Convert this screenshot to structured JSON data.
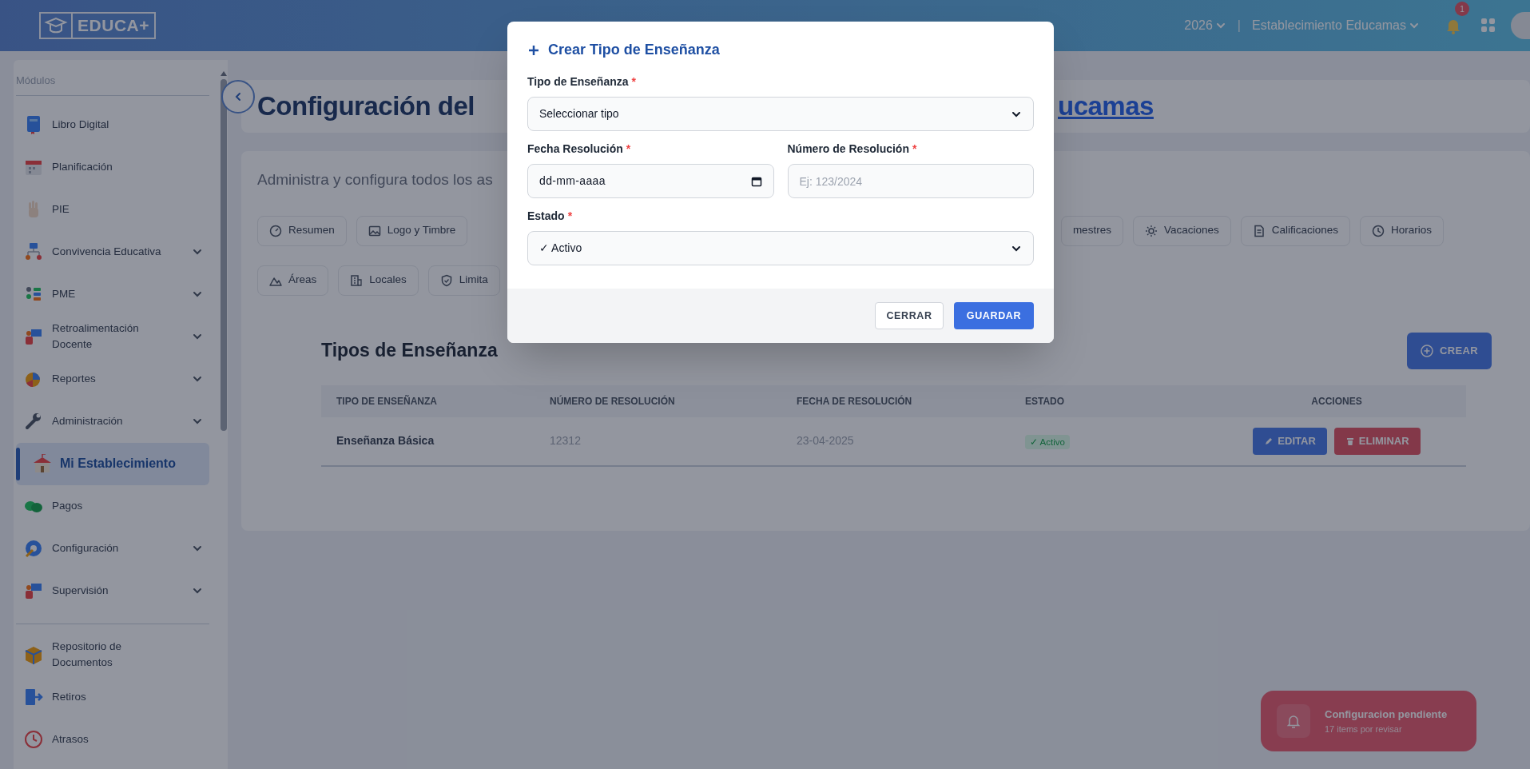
{
  "header": {
    "logo_text": "EDUCA+",
    "year": "2026",
    "separator": "|",
    "school": "Establecimiento Educamas",
    "notification_count": "1"
  },
  "sidebar": {
    "section": "Módulos",
    "items": [
      {
        "label": "Libro Digital",
        "expandable": false,
        "selected": false
      },
      {
        "label": "Planificación",
        "expandable": false,
        "selected": false
      },
      {
        "label": "PIE",
        "expandable": false,
        "selected": false
      },
      {
        "label": "Convivencia Educativa",
        "expandable": true,
        "selected": false
      },
      {
        "label": "PME",
        "expandable": true,
        "selected": false
      },
      {
        "label": "Retroalimentación Docente",
        "expandable": true,
        "selected": false
      },
      {
        "label": "Reportes",
        "expandable": true,
        "selected": false
      },
      {
        "label": "Administración",
        "expandable": true,
        "selected": false
      },
      {
        "label": "Mi Establecimiento",
        "expandable": false,
        "selected": true
      },
      {
        "label": "Pagos",
        "expandable": false,
        "selected": false
      },
      {
        "label": "Configuración",
        "expandable": true,
        "selected": false
      },
      {
        "label": "Supervisión",
        "expandable": true,
        "selected": false
      }
    ],
    "bottom_items": [
      {
        "label": "Repositorio de Documentos",
        "expandable": false,
        "selected": false
      },
      {
        "label": "Retiros",
        "expandable": false,
        "selected": false
      },
      {
        "label": "Atrasos",
        "expandable": false,
        "selected": false
      }
    ]
  },
  "page": {
    "title": "Configuración del",
    "title_end": "ucamas",
    "subtitle": "Administra y configura todos los as"
  },
  "tab_rows": [
    {
      "left": [
        "Resumen",
        "Logo y Timbre"
      ],
      "right": [
        "mestres",
        "Vacaciones",
        "Calificaciones",
        "Horarios"
      ]
    },
    {
      "left": [
        "Áreas",
        "Locales",
        "Limita"
      ],
      "right": []
    }
  ],
  "section": {
    "title": "Tipos de Enseñanza",
    "create_button": "CREAR",
    "columns": [
      "TIPO DE ENSEÑANZA",
      "NÚMERO DE RESOLUCIÓN",
      "FECHA DE RESOLUCIÓN",
      "ESTADO",
      "ACCIONES"
    ],
    "rows": [
      {
        "tipo": "Enseñanza Básica",
        "numero": "12312",
        "fecha": "23-04-2025",
        "estado": "✓ Activo",
        "edit": "EDITAR",
        "delete": "ELIMINAR"
      }
    ]
  },
  "modal": {
    "title": "Crear Tipo de Enseñanza",
    "field_rows": [
      [
        {
          "kind": "select",
          "label": "Tipo de Enseñanza",
          "required_mark": "*",
          "value": "Seleccionar tipo"
        }
      ],
      [
        {
          "kind": "date",
          "label": "Fecha Resolución",
          "required_mark": "*",
          "value": "dd-mm-aaaa"
        },
        {
          "kind": "text",
          "label": "Número de Resolución",
          "required_mark": "*",
          "placeholder": "Ej: 123/2024"
        }
      ],
      [
        {
          "kind": "select",
          "label": "Estado",
          "required_mark": "*",
          "value": "✓ Activo"
        }
      ]
    ],
    "buttons": [
      {
        "label": "CERRAR",
        "kind": "secondary"
      },
      {
        "label": "GUARDAR",
        "kind": "primary"
      }
    ]
  },
  "toast": {
    "title": "Configuracion pendiente",
    "subtitle": "17 items por revisar"
  }
}
